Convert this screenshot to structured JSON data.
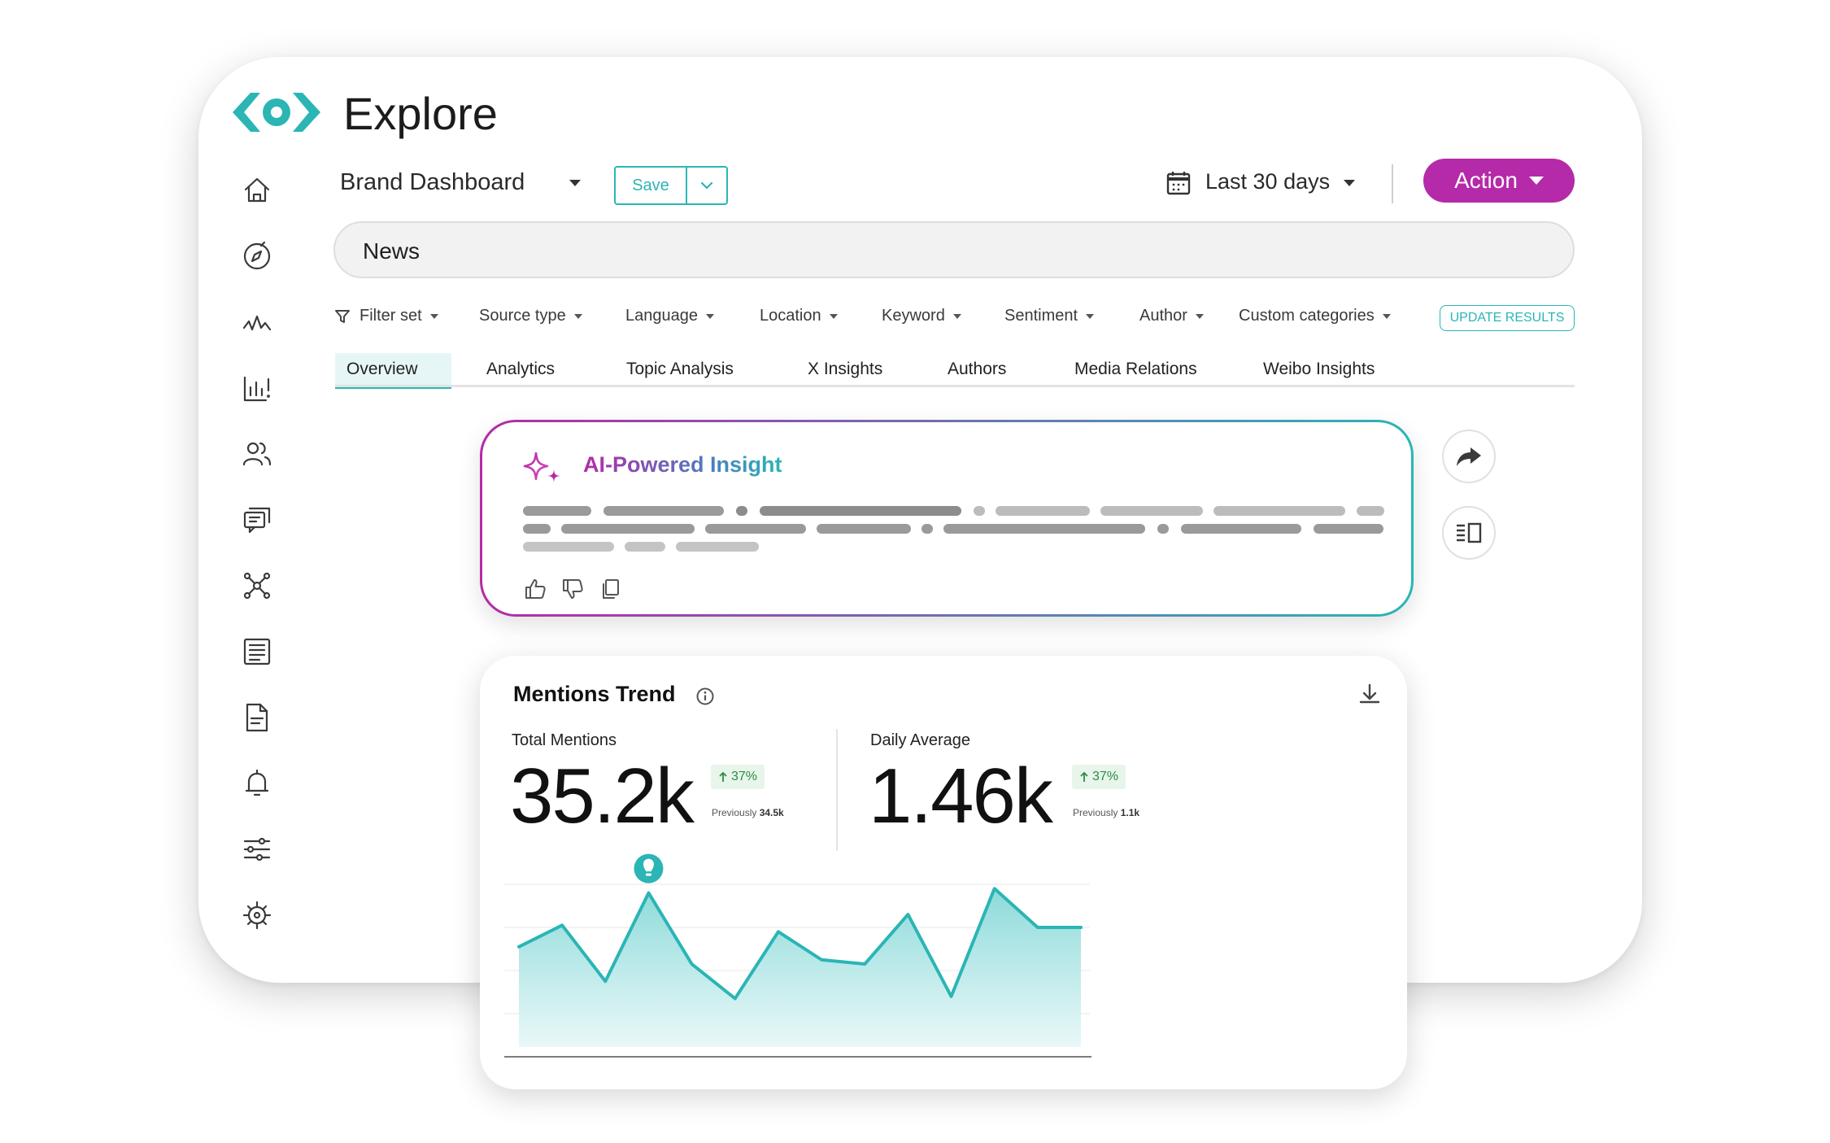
{
  "app": {
    "title": "Explore",
    "brand_colors": {
      "teal": "#2bb5b5",
      "magenta": "#b52aa8"
    }
  },
  "sidebar": {
    "items": [
      {
        "icon": "home-icon"
      },
      {
        "icon": "compass-icon"
      },
      {
        "icon": "pulse-icon"
      },
      {
        "icon": "bar-chart-alert-icon"
      },
      {
        "icon": "people-icon"
      },
      {
        "icon": "chat-icon"
      },
      {
        "icon": "network-icon"
      },
      {
        "icon": "newspaper-icon"
      },
      {
        "icon": "document-icon"
      },
      {
        "icon": "bell-icon"
      },
      {
        "icon": "sliders-icon"
      },
      {
        "icon": "settings-icon"
      }
    ]
  },
  "toolbar": {
    "dashboard_name": "Brand Dashboard",
    "save_label": "Save",
    "date_range": "Last 30 days",
    "action_label": "Action"
  },
  "search": {
    "value": "News"
  },
  "filters": {
    "items": [
      "Filter set",
      "Source type",
      "Language",
      "Location",
      "Keyword",
      "Sentiment",
      "Author",
      "Custom categories"
    ],
    "update_label": "UPDATE RESULTS"
  },
  "tabs": {
    "items": [
      "Overview",
      "Analytics",
      "Topic Analysis",
      "X Insights",
      "Authors",
      "Media Relations",
      "Weibo Insights"
    ],
    "active": "Overview"
  },
  "ai_insight": {
    "title": "AI-Powered Insight",
    "actions": [
      "thumbs-up-icon",
      "thumbs-down-icon",
      "copy-icon"
    ]
  },
  "side_actions": [
    "share-icon",
    "panel-layout-icon"
  ],
  "mentions_trend": {
    "title": "Mentions Trend",
    "total": {
      "label": "Total Mentions",
      "value": "35.2k",
      "delta": "37%",
      "previous_label": "Previously",
      "previous_value": "34.5k"
    },
    "daily": {
      "label": "Daily Average",
      "value": "1.46k",
      "delta": "37%",
      "previous_label": "Previously",
      "previous_value": "1.1k"
    }
  },
  "chart_data": {
    "type": "area",
    "title": "Mentions Trend",
    "x": [
      1,
      2,
      3,
      4,
      5,
      6,
      7,
      8,
      9,
      10,
      11,
      12,
      13,
      14,
      15
    ],
    "values": [
      51,
      61,
      35,
      76,
      43,
      27,
      58,
      45,
      43,
      66,
      28,
      78,
      60,
      60
    ],
    "ylim": [
      0,
      100
    ],
    "grid": true,
    "highlight_index": 3,
    "highlight_icon": "lightbulb-icon",
    "colors": {
      "line": "#2bb5b5",
      "fill_top": "#8ddada",
      "fill_bottom": "#e6f7f7"
    }
  }
}
